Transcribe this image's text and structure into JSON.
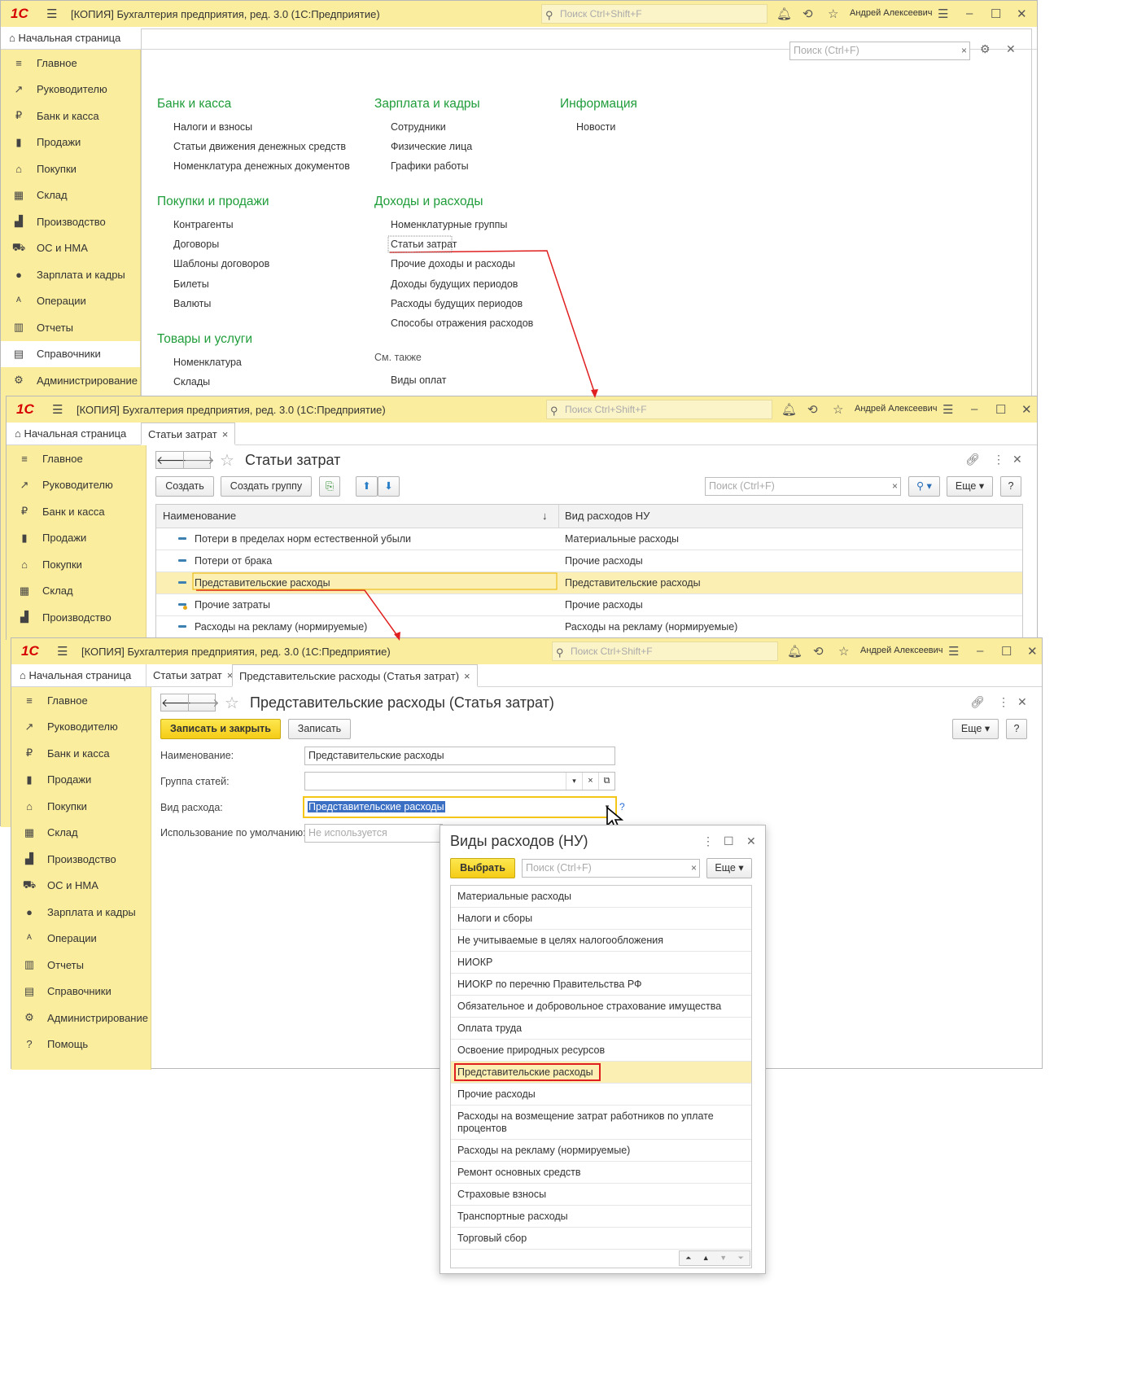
{
  "app": {
    "logo": "1С",
    "title": "[КОПИЯ] Бухгалтерия предприятия, ред. 3.0  (1С:Предприятие)",
    "search_placeholder": "Поиск Ctrl+Shift+F",
    "user": "Андрей Алексеевич"
  },
  "w1": {
    "tab_home": "Начальная страница",
    "panel_search_placeholder": "Поиск (Ctrl+F)",
    "sidebar": [
      "Главное",
      "Руководителю",
      "Банк и касса",
      "Продажи",
      "Покупки",
      "Склад",
      "Производство",
      "ОС и НМА",
      "Зарплата и кадры",
      "Операции",
      "Отчеты",
      "Справочники",
      "Администрирование"
    ],
    "sidebar_icons": [
      "≡",
      "↗",
      "₽",
      "▮",
      "⌂",
      "▦",
      "▟",
      "⛟",
      "●",
      "ᴬ",
      "▥",
      "▤",
      "⚙"
    ],
    "groups": [
      {
        "title": "Банк и касса",
        "items": [
          "Налоги и взносы",
          "Статьи движения денежных средств",
          "Номенклатура денежных документов"
        ]
      },
      {
        "title": "Покупки и продажи",
        "items": [
          "Контрагенты",
          "Договоры",
          "Шаблоны договоров",
          "Билеты",
          "Валюты"
        ]
      },
      {
        "title": "Товары и услуги",
        "items": [
          "Номенклатура",
          "Склады"
        ]
      },
      {
        "title": "Зарплата и кадры",
        "items": [
          "Сотрудники",
          "Физические лица",
          "Графики работы"
        ]
      },
      {
        "title": "Доходы и расходы",
        "items": [
          "Номенклатурные группы",
          "Статьи затрат",
          "Прочие доходы и расходы",
          "Доходы будущих периодов",
          "Расходы будущих периодов",
          "Способы отражения расходов"
        ]
      },
      {
        "title": "Информация",
        "items": [
          "Новости"
        ]
      }
    ],
    "see_also_label": "См. также",
    "see_also_items": [
      "Виды оплат"
    ]
  },
  "w2": {
    "tab_home": "Начальная страница",
    "tab_active": "Статьи затрат",
    "sidebar": [
      "Главное",
      "Руководителю",
      "Банк и касса",
      "Продажи",
      "Покупки",
      "Склад",
      "Производство"
    ],
    "page_title": "Статьи затрат",
    "btn_create": "Создать",
    "btn_create_group": "Создать группу",
    "search_placeholder": "Поиск (Ctrl+F)",
    "btn_more": "Еще",
    "btn_help": "?",
    "col_name": "Наименование",
    "col_kind": "Вид расходов НУ",
    "rows": [
      {
        "name": "Потери в пределах норм естественной убыли",
        "kind": "Материальные расходы"
      },
      {
        "name": "Потери от брака",
        "kind": "Прочие расходы"
      },
      {
        "name": "Представительские расходы",
        "kind": "Представительские расходы"
      },
      {
        "name": "Прочие затраты",
        "kind": "Прочие расходы"
      },
      {
        "name": "Расходы на рекламу (нормируемые)",
        "kind": "Расходы на рекламу (нормируемые)"
      }
    ]
  },
  "w3": {
    "tab_home": "Начальная страница",
    "tab2": "Статьи затрат",
    "tab_active": "Представительские расходы (Статья затрат)",
    "sidebar": [
      "Главное",
      "Руководителю",
      "Банк и касса",
      "Продажи",
      "Покупки",
      "Склад",
      "Производство",
      "ОС и НМА",
      "Зарплата и кадры",
      "Операции",
      "Отчеты",
      "Справочники",
      "Администрирование",
      "Помощь"
    ],
    "page_title": "Представительские расходы (Статья затрат)",
    "btn_save_close": "Записать и закрыть",
    "btn_save": "Записать",
    "btn_more": "Еще",
    "btn_help": "?",
    "label_name": "Наименование:",
    "value_name": "Представительские расходы",
    "label_group": "Группа статей:",
    "value_group": "",
    "label_kind": "Вид расхода:",
    "value_kind": "Представительские расходы",
    "label_default": "Использование по умолчанию:",
    "placeholder_default": "Не используется",
    "hint": "?"
  },
  "popup": {
    "title": "Виды расходов (НУ)",
    "btn_select": "Выбрать",
    "search_placeholder": "Поиск (Ctrl+F)",
    "btn_more": "Еще",
    "items": [
      "Материальные расходы",
      "Налоги и сборы",
      "Не учитываемые в целях налогообложения",
      "НИОКР",
      "НИОКР по перечню Правительства РФ",
      "Обязательное и добровольное страхование имущества",
      "Оплата труда",
      "Освоение природных ресурсов",
      "Представительские расходы",
      "Прочие расходы",
      "Расходы на возмещение затрат работников по уплате процентов",
      "Расходы на рекламу (нормируемые)",
      "Ремонт основных средств",
      "Страховые взносы",
      "Транспортные расходы",
      "Торговый сбор"
    ],
    "selected_index": 8
  },
  "colors": {
    "accent": "#fbed9e",
    "link_group": "#1f9d3a",
    "selection": "#fcefb4",
    "arrow": "#e02020"
  }
}
